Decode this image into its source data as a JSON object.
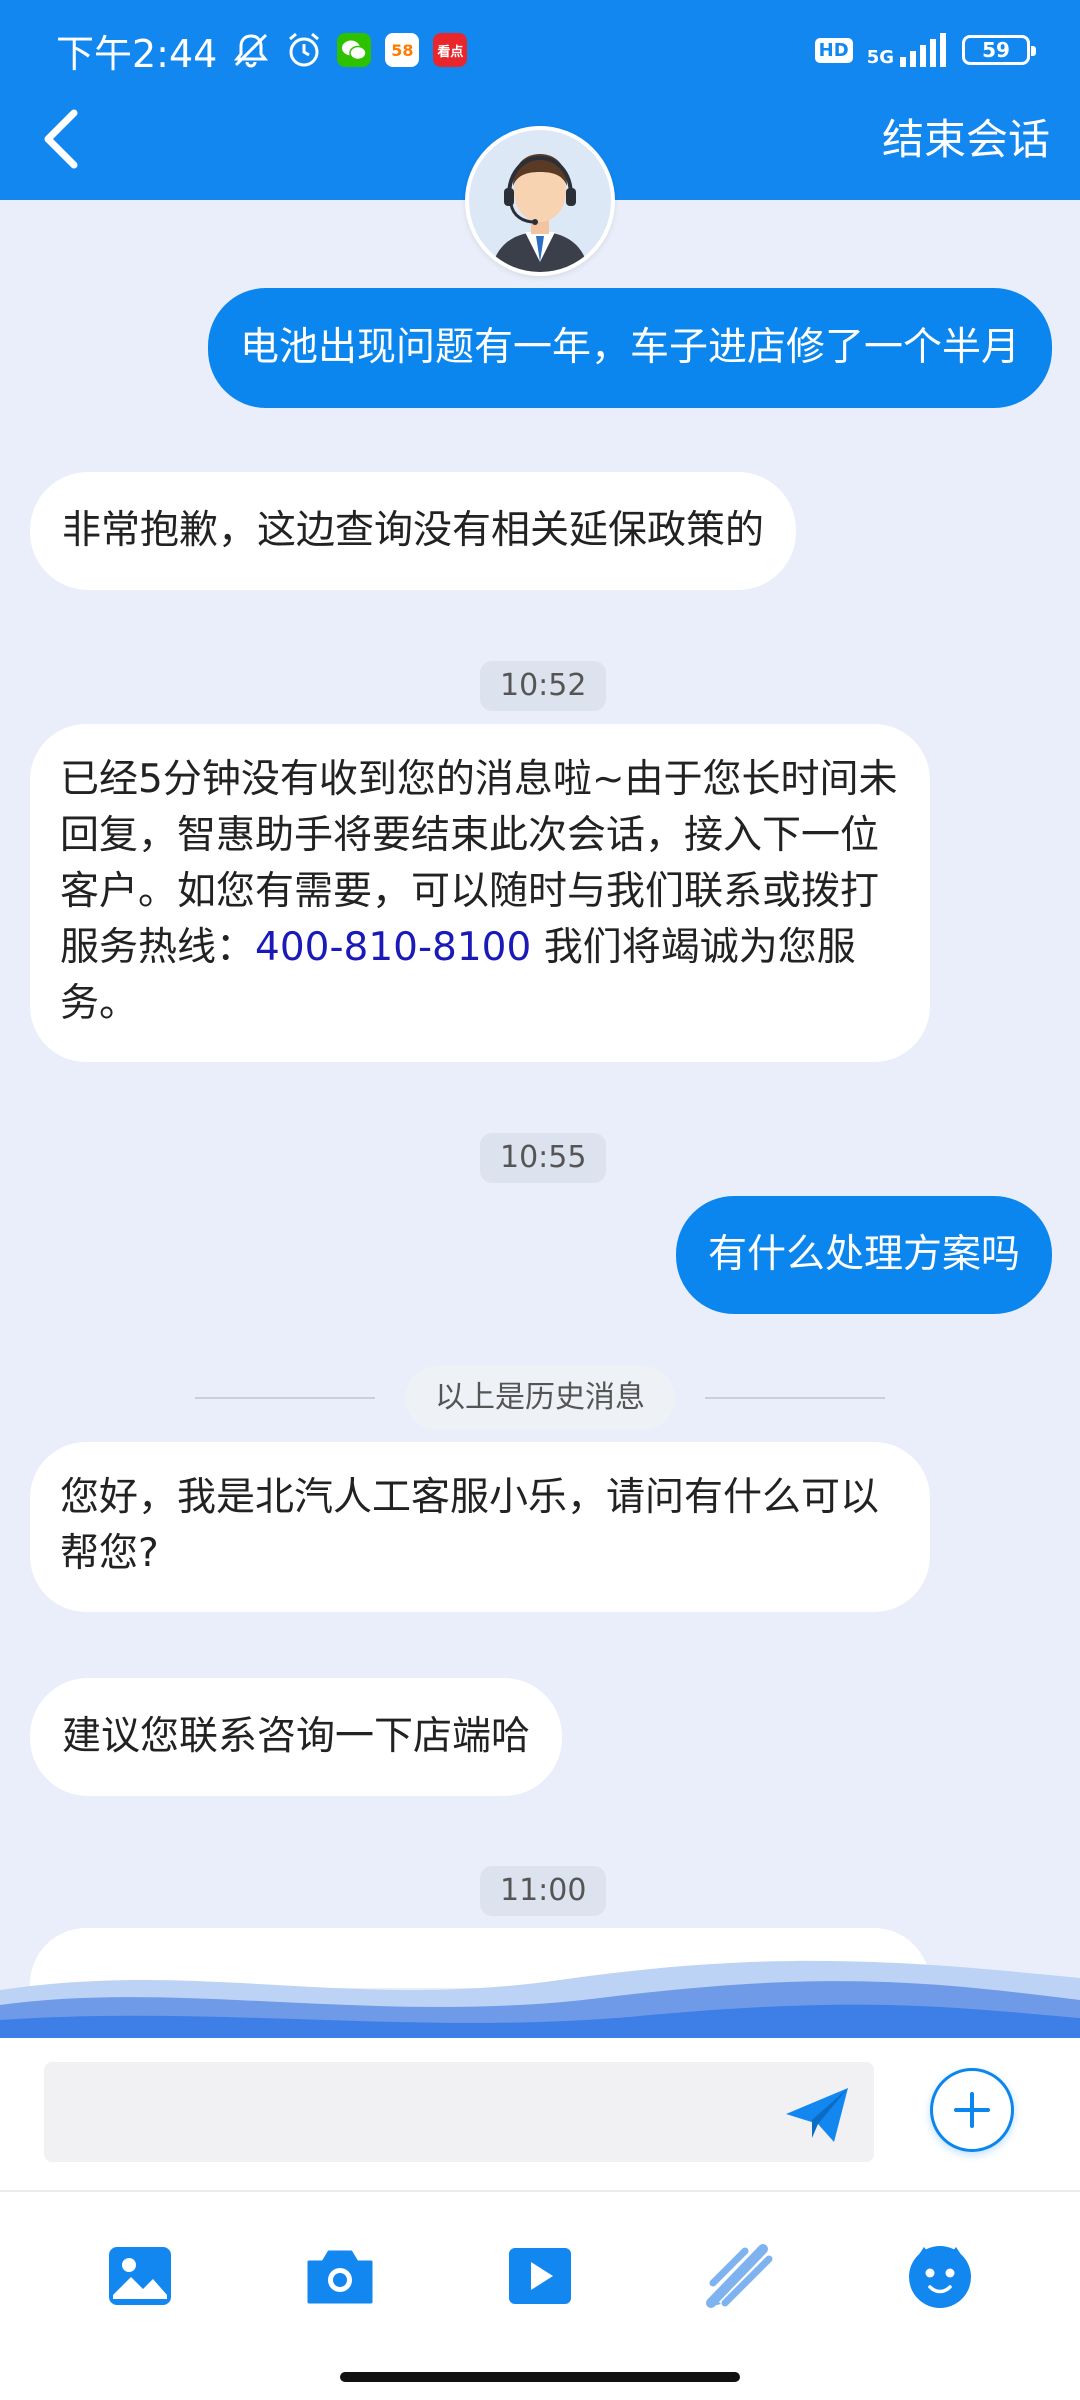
{
  "status_bar": {
    "time": "下午2:44",
    "apps": [
      {
        "name": "wechat-app-icon",
        "label": "",
        "color": "#2dc100"
      },
      {
        "name": "58-app-icon",
        "label": "58",
        "color": "#ff7a00"
      },
      {
        "name": "news-app-icon",
        "label": "看点",
        "color": "#e8262b"
      }
    ],
    "hd": "HD",
    "network": "5G",
    "battery": "59"
  },
  "header": {
    "end_chat_label": "结束会话",
    "background_color": "#1287f0"
  },
  "messages": [
    {
      "side": "user",
      "text": "电池出现问题有一年，车子进店修了一个半月"
    },
    {
      "side": "bot",
      "text": "非常抱歉，这边查询没有相关延保政策的"
    },
    {
      "time": "10:52"
    },
    {
      "side": "bot",
      "text_before": "已经5分钟没有收到您的消息啦~由于您长时间未回复，智惠助手将要结束此次会话，接入下一位客户。如您有需要，可以随时与我们联系或拨打服务热线：",
      "phone": "400-810-8100",
      "text_after": " 我们将竭诚为您服务。"
    },
    {
      "time": "10:55"
    },
    {
      "side": "user",
      "text": "有什么处理方案吗"
    },
    {
      "divider": "以上是历史消息"
    },
    {
      "side": "bot",
      "text": "您好，我是北汽人工客服小乐，请问有什么可以帮您?"
    },
    {
      "side": "bot",
      "text": "建议您联系咨询一下店端哈"
    },
    {
      "time": "11:00"
    }
  ],
  "input": {
    "value": "",
    "placeholder": ""
  },
  "toolbar": {
    "buttons": [
      "image-icon",
      "camera-icon",
      "video-icon",
      "brush-icon",
      "emoji-icon"
    ]
  },
  "colors": {
    "accent": "#0b86ee",
    "chat_background": "#e9eefa"
  }
}
